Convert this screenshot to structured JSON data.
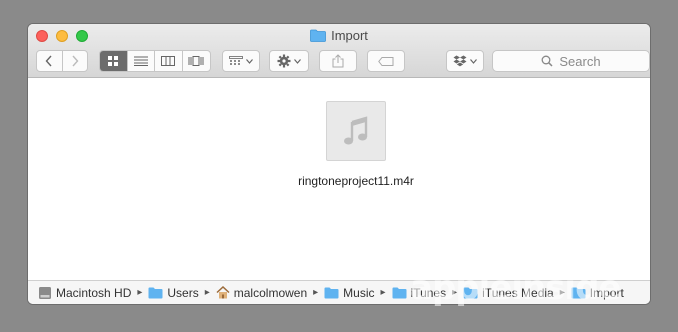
{
  "window": {
    "title": "Import"
  },
  "toolbar": {
    "search_placeholder": "Search"
  },
  "files": [
    {
      "name": "ringtoneproject11.m4r",
      "icon": "music-note-icon"
    }
  ],
  "pathbar": {
    "items": [
      {
        "label": "Macintosh HD",
        "icon": "hard-drive-icon"
      },
      {
        "label": "Users",
        "icon": "folder-icon"
      },
      {
        "label": "malcolmowen",
        "icon": "home-icon"
      },
      {
        "label": "Music",
        "icon": "folder-icon"
      },
      {
        "label": "iTunes",
        "icon": "folder-icon"
      },
      {
        "label": "iTunes Media",
        "icon": "folder-icon"
      },
      {
        "label": "Import",
        "icon": "folder-icon"
      }
    ]
  },
  "watermark": "appleinside"
}
